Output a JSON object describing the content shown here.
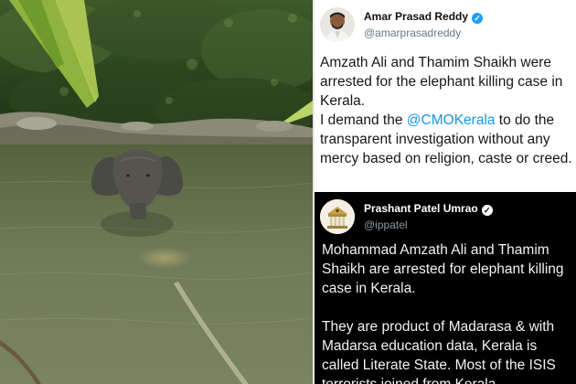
{
  "tweet1": {
    "name": "Amar Prasad Reddy",
    "handle": "@amarprasadreddy",
    "text_before_mention": "Amzath Ali and Thamim Shaikh were arrested for the elephant killing case in Kerala.",
    "text_line_break_part": "I demand the ",
    "mention": "@CMOKerala",
    "text_after_mention": " to do the transparent investigation without any mercy based on religion, caste or creed."
  },
  "tweet2": {
    "name": "Prashant Patel Umrao",
    "handle": "@ippatel",
    "paragraph1": "Mohammad Amzath Ali and Thamim Shaikh are arrested for elephant killing case in Kerala.",
    "paragraph2": "They are product of Madarasa & with Madarsa education data, Kerala is called Literate State. Most of the ISIS terrorists joined from Kerala."
  },
  "icons": {
    "verified": "verified-badge-icon"
  },
  "colors": {
    "mention": "#1b95e0",
    "verified": "#1da1f2"
  }
}
